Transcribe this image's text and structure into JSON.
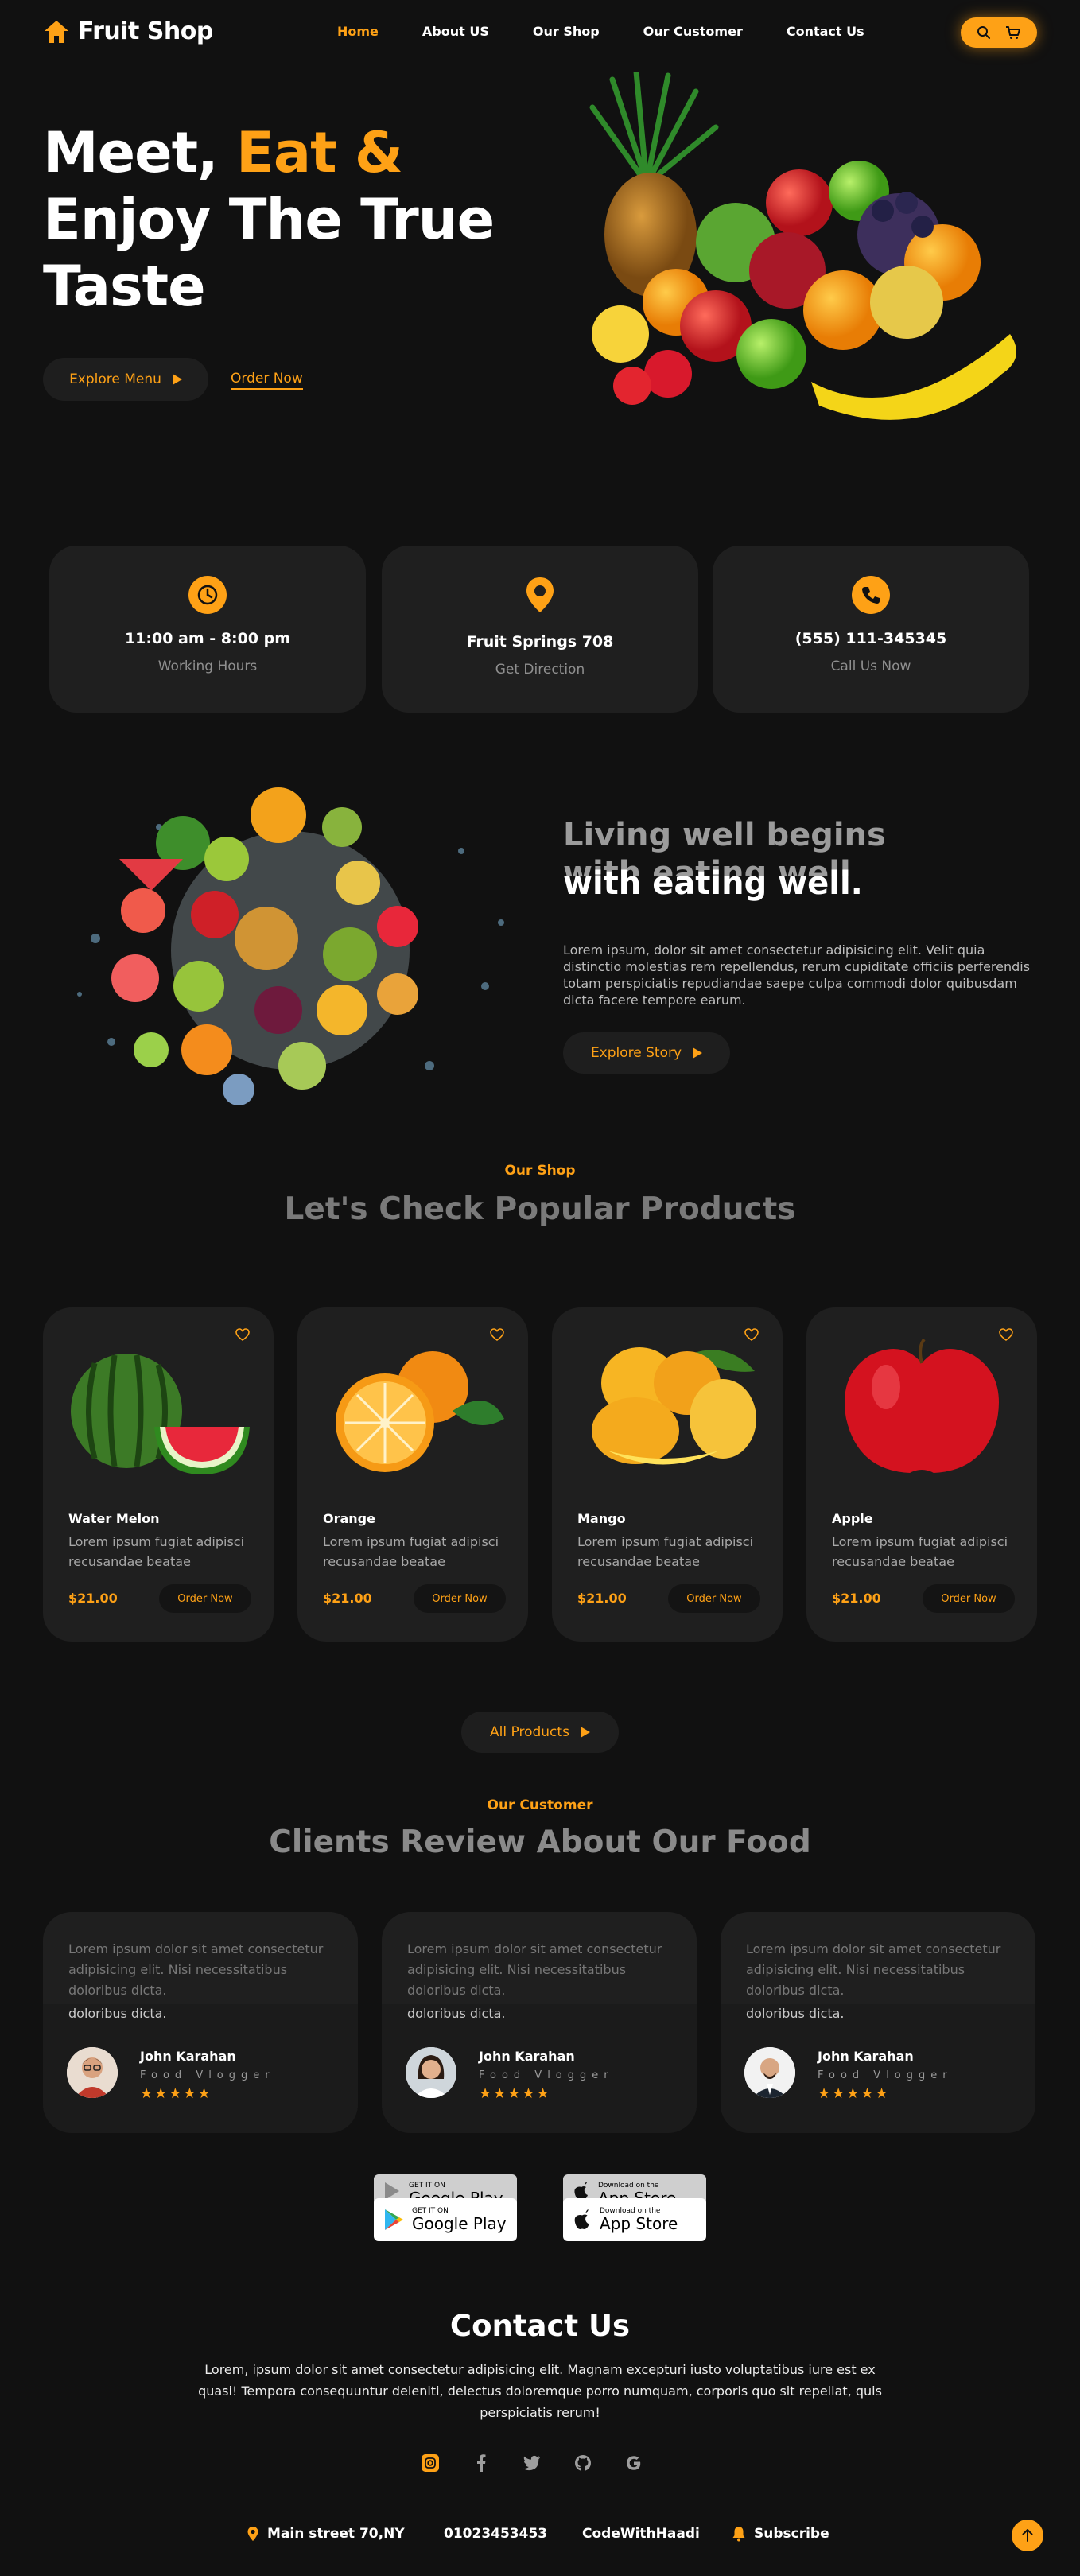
{
  "brand": {
    "name": "Fruit Shop"
  },
  "nav": [
    "Home",
    "About US",
    "Our Shop",
    "Our Customer",
    "Contact Us"
  ],
  "hero": {
    "title_part1": "Meet,",
    "title_accent": "Eat &",
    "title_line2": "Enjoy The True",
    "title_line3": "Taste",
    "explore_btn": "Explore Menu",
    "order_link": "Order Now"
  },
  "info": [
    {
      "title": "11:00 am - 8:00 pm",
      "sub": "Working Hours"
    },
    {
      "title": "Fruit Springs 708",
      "sub": "Get Direction"
    },
    {
      "title": "(555) 111-345345",
      "sub": "Call Us Now"
    }
  ],
  "about": {
    "heading_line1": "Living well begins",
    "heading_line2_ghost": "with eating well.",
    "heading_line2": "with eating well.",
    "text": "Lorem ipsum, dolor sit amet consectetur adipisicing elit. Velit quia distinctio molestias rem repellendus, rerum cupiditate officiis perferendis totam perspiciatis repudiandae saepe culpa commodi dolor quibusdam dicta facere tempore earum.",
    "button": "Explore Story"
  },
  "shop": {
    "label": "Our Shop",
    "title": "Let's Check Popular Products",
    "products": [
      {
        "name": "Water Melon",
        "desc": "Lorem ipsum fugiat adipisci recusandae beatae",
        "price": "$21.00",
        "button": "Order Now"
      },
      {
        "name": "Orange",
        "desc": "Lorem ipsum fugiat adipisci recusandae beatae",
        "price": "$21.00",
        "button": "Order Now"
      },
      {
        "name": "Mango",
        "desc": "Lorem ipsum fugiat adipisci recusandae beatae",
        "price": "$21.00",
        "button": "Order Now"
      },
      {
        "name": "Apple",
        "desc": "Lorem ipsum fugiat adipisci recusandae beatae",
        "price": "$21.00",
        "button": "Order Now"
      }
    ],
    "all_button": "All Products"
  },
  "reviews": {
    "label": "Our Customer",
    "title": "Clients Review About Our Food",
    "items": [
      {
        "text": "Lorem ipsum dolor sit amet consectetur adipisicing elit. Nisi necessitatibus doloribus dicta.",
        "text_repeat": "doloribus dicta.",
        "name": "John Karahan",
        "role": "Food Vlogger",
        "stars": "★★★★★"
      },
      {
        "text": "Lorem ipsum dolor sit amet consectetur adipisicing elit. Nisi necessitatibus doloribus dicta.",
        "text_repeat": "doloribus dicta.",
        "name": "John Karahan",
        "role": "Food Vlogger",
        "stars": "★★★★★"
      },
      {
        "text": "Lorem ipsum dolor sit amet consectetur adipisicing elit. Nisi necessitatibus doloribus dicta.",
        "text_repeat": "doloribus dicta.",
        "name": "John Karahan",
        "role": "Food Vlogger",
        "stars": "★★★★★"
      }
    ]
  },
  "stores": {
    "google_small": "GET IT ON",
    "google_big": "Google Play",
    "apple_small": "Download on the",
    "apple_big": "App Store"
  },
  "contact": {
    "title": "Contact Us",
    "text": "Lorem, ipsum dolor sit amet consectetur adipisicing elit. Magnam excepturi iusto voluptatibus iure est ex quasi! Tempora consequuntur deleniti, delectus doloremque porro numquam, corporis quo sit repellat, quis perspiciatis rerum!"
  },
  "footer": {
    "address": "Main street 70,NY",
    "phone": "01023453453",
    "handle": "CodeWithHaadi",
    "subscribe": "Subscribe"
  },
  "colors": {
    "accent": "#fea116",
    "background": "#111111",
    "card": "#1f1f1f"
  },
  "icons": [
    "home-icon",
    "search-icon",
    "cart-icon",
    "play-icon",
    "clock-icon",
    "location-icon",
    "phone-icon",
    "heart-icon",
    "instagram-icon",
    "facebook-icon",
    "twitter-icon",
    "github-icon",
    "google-icon",
    "bell-icon",
    "arrow-up-icon"
  ]
}
